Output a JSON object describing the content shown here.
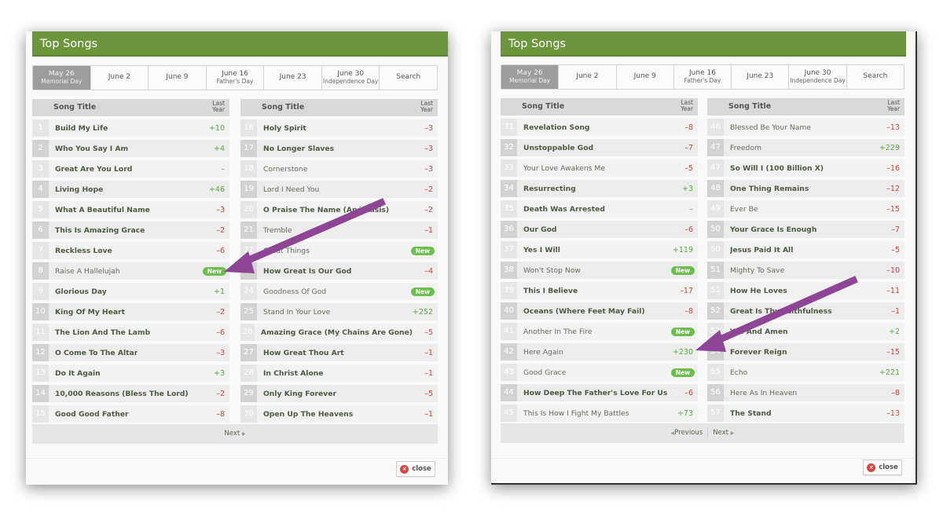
{
  "panels": [
    {
      "title": "Top Songs",
      "tabs": [
        {
          "label": "May 26",
          "sub": "Memorial Day",
          "active": true
        },
        {
          "label": "June 2",
          "sub": ""
        },
        {
          "label": "June 9",
          "sub": ""
        },
        {
          "label": "June 16",
          "sub": "Father's Day"
        },
        {
          "label": "June 23",
          "sub": ""
        },
        {
          "label": "June 30",
          "sub": "Independence Day"
        },
        {
          "label": "Search",
          "sub": ""
        }
      ],
      "column_header": {
        "title": "Song Title",
        "last_year_line1": "Last",
        "last_year_line2": "Year"
      },
      "columns": [
        [
          {
            "rank": "1",
            "title": "Build My Life",
            "change": "+10",
            "trend": "up",
            "bold": true
          },
          {
            "rank": "2",
            "title": "Who You Say I Am",
            "change": "+4",
            "trend": "up",
            "bold": true
          },
          {
            "rank": "3",
            "title": "Great Are You Lord",
            "change": "–",
            "trend": "same",
            "bold": true
          },
          {
            "rank": "4",
            "title": "Living Hope",
            "change": "+46",
            "trend": "up",
            "bold": true
          },
          {
            "rank": "5",
            "title": "What A Beautiful Name",
            "change": "–3",
            "trend": "down",
            "bold": true
          },
          {
            "rank": "6",
            "title": "This Is Amazing Grace",
            "change": "–2",
            "trend": "down",
            "bold": true
          },
          {
            "rank": "7",
            "title": "Reckless Love",
            "change": "–6",
            "trend": "down",
            "bold": true
          },
          {
            "rank": "8",
            "title": "Raise A Hallelujah",
            "change": "New",
            "trend": "new",
            "bold": false
          },
          {
            "rank": "9",
            "title": "Glorious Day",
            "change": "+1",
            "trend": "up",
            "bold": true
          },
          {
            "rank": "10",
            "title": "King Of My Heart",
            "change": "–2",
            "trend": "down",
            "bold": true
          },
          {
            "rank": "11",
            "title": "The Lion And The Lamb",
            "change": "–6",
            "trend": "down",
            "bold": true
          },
          {
            "rank": "12",
            "title": "O Come To The Altar",
            "change": "–3",
            "trend": "down",
            "bold": true
          },
          {
            "rank": "13",
            "title": "Do It Again",
            "change": "+3",
            "trend": "up",
            "bold": true
          },
          {
            "rank": "14",
            "title": "10,000 Reasons (Bless The Lord)",
            "change": "–2",
            "trend": "down",
            "bold": true
          },
          {
            "rank": "15",
            "title": "Good Good Father",
            "change": "–8",
            "trend": "down",
            "bold": true
          }
        ],
        [
          {
            "rank": "16",
            "title": "Holy Spirit",
            "change": "–3",
            "trend": "down",
            "bold": true
          },
          {
            "rank": "17",
            "title": "No Longer Slaves",
            "change": "–3",
            "trend": "down",
            "bold": true
          },
          {
            "rank": "18",
            "title": "Cornerstone",
            "change": "–3",
            "trend": "down",
            "bold": false
          },
          {
            "rank": "19",
            "title": "Lord I Need You",
            "change": "–2",
            "trend": "down",
            "bold": false
          },
          {
            "rank": "20",
            "title": "O Praise The Name (Anástasis)",
            "change": "–2",
            "trend": "down",
            "bold": true
          },
          {
            "rank": "21",
            "title": "Tremble",
            "change": "–1",
            "trend": "down",
            "bold": false
          },
          {
            "rank": "22",
            "title": "Great Things",
            "change": "New",
            "trend": "new",
            "bold": false
          },
          {
            "rank": "23",
            "title": "How Great Is Our God",
            "change": "–4",
            "trend": "down",
            "bold": true
          },
          {
            "rank": "24",
            "title": "Goodness Of God",
            "change": "New",
            "trend": "new",
            "bold": false
          },
          {
            "rank": "25",
            "title": "Stand In Your Love",
            "change": "+252",
            "trend": "up",
            "bold": false
          },
          {
            "rank": "26",
            "title": "Amazing Grace (My Chains Are Gone)",
            "change": "–5",
            "trend": "down",
            "bold": true
          },
          {
            "rank": "27",
            "title": "How Great Thou Art",
            "change": "–1",
            "trend": "down",
            "bold": true
          },
          {
            "rank": "28",
            "title": "In Christ Alone",
            "change": "–1",
            "trend": "down",
            "bold": true
          },
          {
            "rank": "29",
            "title": "Only King Forever",
            "change": "–5",
            "trend": "down",
            "bold": true
          },
          {
            "rank": "30",
            "title": "Open Up The Heavens",
            "change": "–1",
            "trend": "down",
            "bold": true
          }
        ]
      ],
      "pager": {
        "previous": "",
        "next": "Next"
      },
      "close_label": "close"
    },
    {
      "title": "Top Songs",
      "tabs": [
        {
          "label": "May 26",
          "sub": "Memorial Day",
          "active": true
        },
        {
          "label": "June 2",
          "sub": ""
        },
        {
          "label": "June 9",
          "sub": ""
        },
        {
          "label": "June 16",
          "sub": "Father's Day"
        },
        {
          "label": "June 23",
          "sub": ""
        },
        {
          "label": "June 30",
          "sub": "Independence Day"
        },
        {
          "label": "Search",
          "sub": ""
        }
      ],
      "column_header": {
        "title": "Song Title",
        "last_year_line1": "Last",
        "last_year_line2": "Year"
      },
      "columns": [
        [
          {
            "rank": "31",
            "title": "Revelation Song",
            "change": "–8",
            "trend": "down",
            "bold": true
          },
          {
            "rank": "32",
            "title": "Unstoppable God",
            "change": "–7",
            "trend": "down",
            "bold": true
          },
          {
            "rank": "33",
            "title": "Your Love Awakens Me",
            "change": "–5",
            "trend": "down",
            "bold": false
          },
          {
            "rank": "34",
            "title": "Resurrecting",
            "change": "+3",
            "trend": "up",
            "bold": true
          },
          {
            "rank": "35",
            "title": "Death Was Arrested",
            "change": "–",
            "trend": "same",
            "bold": true
          },
          {
            "rank": "36",
            "title": "Our God",
            "change": "–6",
            "trend": "down",
            "bold": true
          },
          {
            "rank": "37",
            "title": "Yes I Will",
            "change": "+119",
            "trend": "up",
            "bold": true
          },
          {
            "rank": "38",
            "title": "Won't Stop Now",
            "change": "New",
            "trend": "new",
            "bold": false
          },
          {
            "rank": "39",
            "title": "This I Believe",
            "change": "–17",
            "trend": "down",
            "bold": true
          },
          {
            "rank": "40",
            "title": "Oceans (Where Feet May Fail)",
            "change": "–8",
            "trend": "down",
            "bold": true
          },
          {
            "rank": "41",
            "title": "Another In The Fire",
            "change": "New",
            "trend": "new",
            "bold": false
          },
          {
            "rank": "42",
            "title": "Here Again",
            "change": "+230",
            "trend": "up",
            "bold": false
          },
          {
            "rank": "43",
            "title": "Good Grace",
            "change": "New",
            "trend": "new",
            "bold": false
          },
          {
            "rank": "44",
            "title": "How Deep The Father's Love For Us",
            "change": "–6",
            "trend": "down",
            "bold": true
          },
          {
            "rank": "45",
            "title": "This Is How I Fight My Battles",
            "change": "+73",
            "trend": "up",
            "bold": false
          }
        ],
        [
          {
            "rank": "46",
            "title": "Blessed Be Your Name",
            "change": "–13",
            "trend": "down",
            "bold": false
          },
          {
            "rank": "47",
            "title": "Freedom",
            "change": "+229",
            "trend": "up",
            "bold": false
          },
          {
            "rank": "47",
            "title": "So Will I (100 Billion X)",
            "change": "–16",
            "trend": "down",
            "bold": true
          },
          {
            "rank": "48",
            "title": "One Thing Remains",
            "change": "–12",
            "trend": "down",
            "bold": true
          },
          {
            "rank": "49",
            "title": "Ever Be",
            "change": "–15",
            "trend": "down",
            "bold": false
          },
          {
            "rank": "50",
            "title": "Your Grace Is Enough",
            "change": "–7",
            "trend": "down",
            "bold": true
          },
          {
            "rank": "50",
            "title": "Jesus Paid It All",
            "change": "–5",
            "trend": "down",
            "bold": true
          },
          {
            "rank": "51",
            "title": "Mighty To Save",
            "change": "–10",
            "trend": "down",
            "bold": false
          },
          {
            "rank": "51",
            "title": "How He Loves",
            "change": "–11",
            "trend": "down",
            "bold": true
          },
          {
            "rank": "52",
            "title": "Great Is Thy Faithfulness",
            "change": "–1",
            "trend": "down",
            "bold": true
          },
          {
            "rank": "53",
            "title": "Yes And Amen",
            "change": "+2",
            "trend": "up",
            "bold": true
          },
          {
            "rank": "54",
            "title": "Forever Reign",
            "change": "–15",
            "trend": "down",
            "bold": true
          },
          {
            "rank": "55",
            "title": "Echo",
            "change": "+221",
            "trend": "up",
            "bold": false
          },
          {
            "rank": "56",
            "title": "Here As In Heaven",
            "change": "–8",
            "trend": "down",
            "bold": false
          },
          {
            "rank": "57",
            "title": "The Stand",
            "change": "–13",
            "trend": "down",
            "bold": true
          }
        ]
      ],
      "pager": {
        "previous": "Previous",
        "next": "Next"
      },
      "close_label": "close"
    }
  ],
  "annotation_color": "#8e4596",
  "header_color": "#6c963b"
}
